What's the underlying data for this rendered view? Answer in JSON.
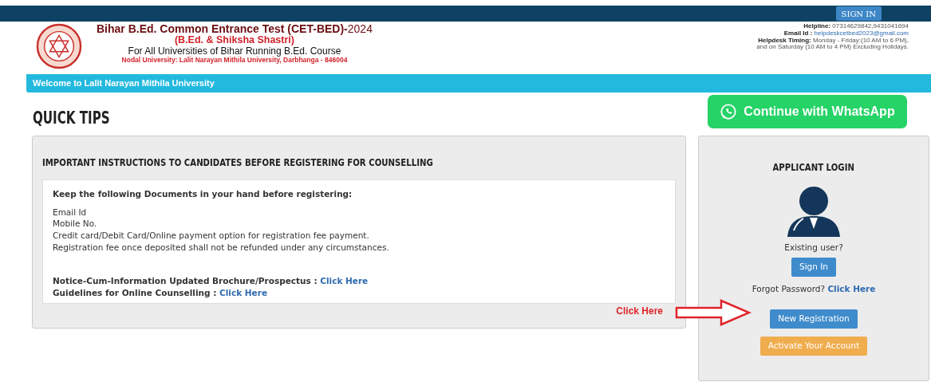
{
  "top_bar": {
    "sign_in": "SIGN IN"
  },
  "header": {
    "title": "Bihar B.Ed. Common Entrance Test (CET-BED)-",
    "year": "2024",
    "subtitle": "(B.Ed. & Shiksha Shastri)",
    "tagline": "For All Universities of Bihar Running B.Ed. Course",
    "nodal": "Nodal University: Lalit Narayan Mithila University, Darbhanga - 846004",
    "contact": [
      {
        "label": "Helpline:",
        "value": "07314629842,9431041694",
        "kind": "text"
      },
      {
        "label": "Email Id :",
        "value": "helpdeskcetbed2023@gmail.com",
        "kind": "link"
      },
      {
        "label": "Helpdesk Timing:",
        "value": "Monday - Friday:(10 AM to 6 PM),",
        "kind": "text"
      },
      {
        "value": "and on Saturday (10 AM to 4 PM) Excluding Holidays.",
        "kind": "text"
      }
    ]
  },
  "welcome": "Welcome to Lalit Narayan Mithila University",
  "page_title": "QUICK TIPS",
  "whatsapp_button": "Continue with WhatsApp",
  "instructions": {
    "heading": "IMPORTANT INSTRUCTIONS TO CANDIDATES BEFORE REGISTERING FOR COUNSELLING",
    "intro": "Keep the following Documents in your hand before registering:",
    "items": [
      "Email Id",
      "Mobile No.",
      "Credit card/Debit Card/Online payment option for registration fee payment.",
      "Registration fee once deposited shall not be refunded under any circumstances."
    ],
    "links": [
      {
        "label": "Notice-Cum-Information Updated Brochure/Prospectus :",
        "link": "Click Here"
      },
      {
        "label": "Guidelines for Online Counselling :",
        "link": "Click Here"
      }
    ]
  },
  "annotation": {
    "text": "Click Here"
  },
  "login": {
    "heading": "APPLICANT LOGIN",
    "existing": "Existing user?",
    "sign_in": "Sign In",
    "forgot": "Forgot Password?",
    "forgot_link": "Click Here",
    "new_registration": "New Registration",
    "activate": "Activate Your Account"
  }
}
